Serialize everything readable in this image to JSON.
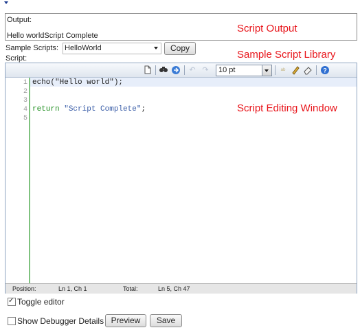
{
  "output": {
    "label": "Output:",
    "text": "Hello worldScript Complete"
  },
  "annotations": {
    "script_output": "Script Output",
    "sample_library": "Sample Script Library",
    "editing_window": "Script Editing Window",
    "color": "#e8141a"
  },
  "samples": {
    "label": "Sample Scripts:",
    "selected": "HelloWorld",
    "copy_label": "Copy"
  },
  "script": {
    "label": "Script:"
  },
  "toolbar": {
    "font_size": "10 pt",
    "icons": [
      "new-document-icon",
      "find-icon",
      "go-to-line-icon",
      "undo-icon",
      "redo-icon",
      "spellcheck-icon",
      "highlight-icon",
      "clear-icon",
      "help-icon"
    ]
  },
  "editor": {
    "line_numbers": [
      "1",
      "2",
      "3",
      "4",
      "5"
    ],
    "code": {
      "line1": "echo(\"Hello world\");",
      "line4_kw": "return",
      "line4_str": "\"Script Complete\"",
      "line4_end": ";"
    }
  },
  "status": {
    "position_label": "Position:",
    "position_value": "Ln 1, Ch 1",
    "total_label": "Total:",
    "total_value": "Ln 5, Ch 47"
  },
  "footer": {
    "toggle_editor": "Toggle editor",
    "show_debugger": "Show Debugger Details",
    "preview_label": "Preview",
    "save_label": "Save"
  }
}
